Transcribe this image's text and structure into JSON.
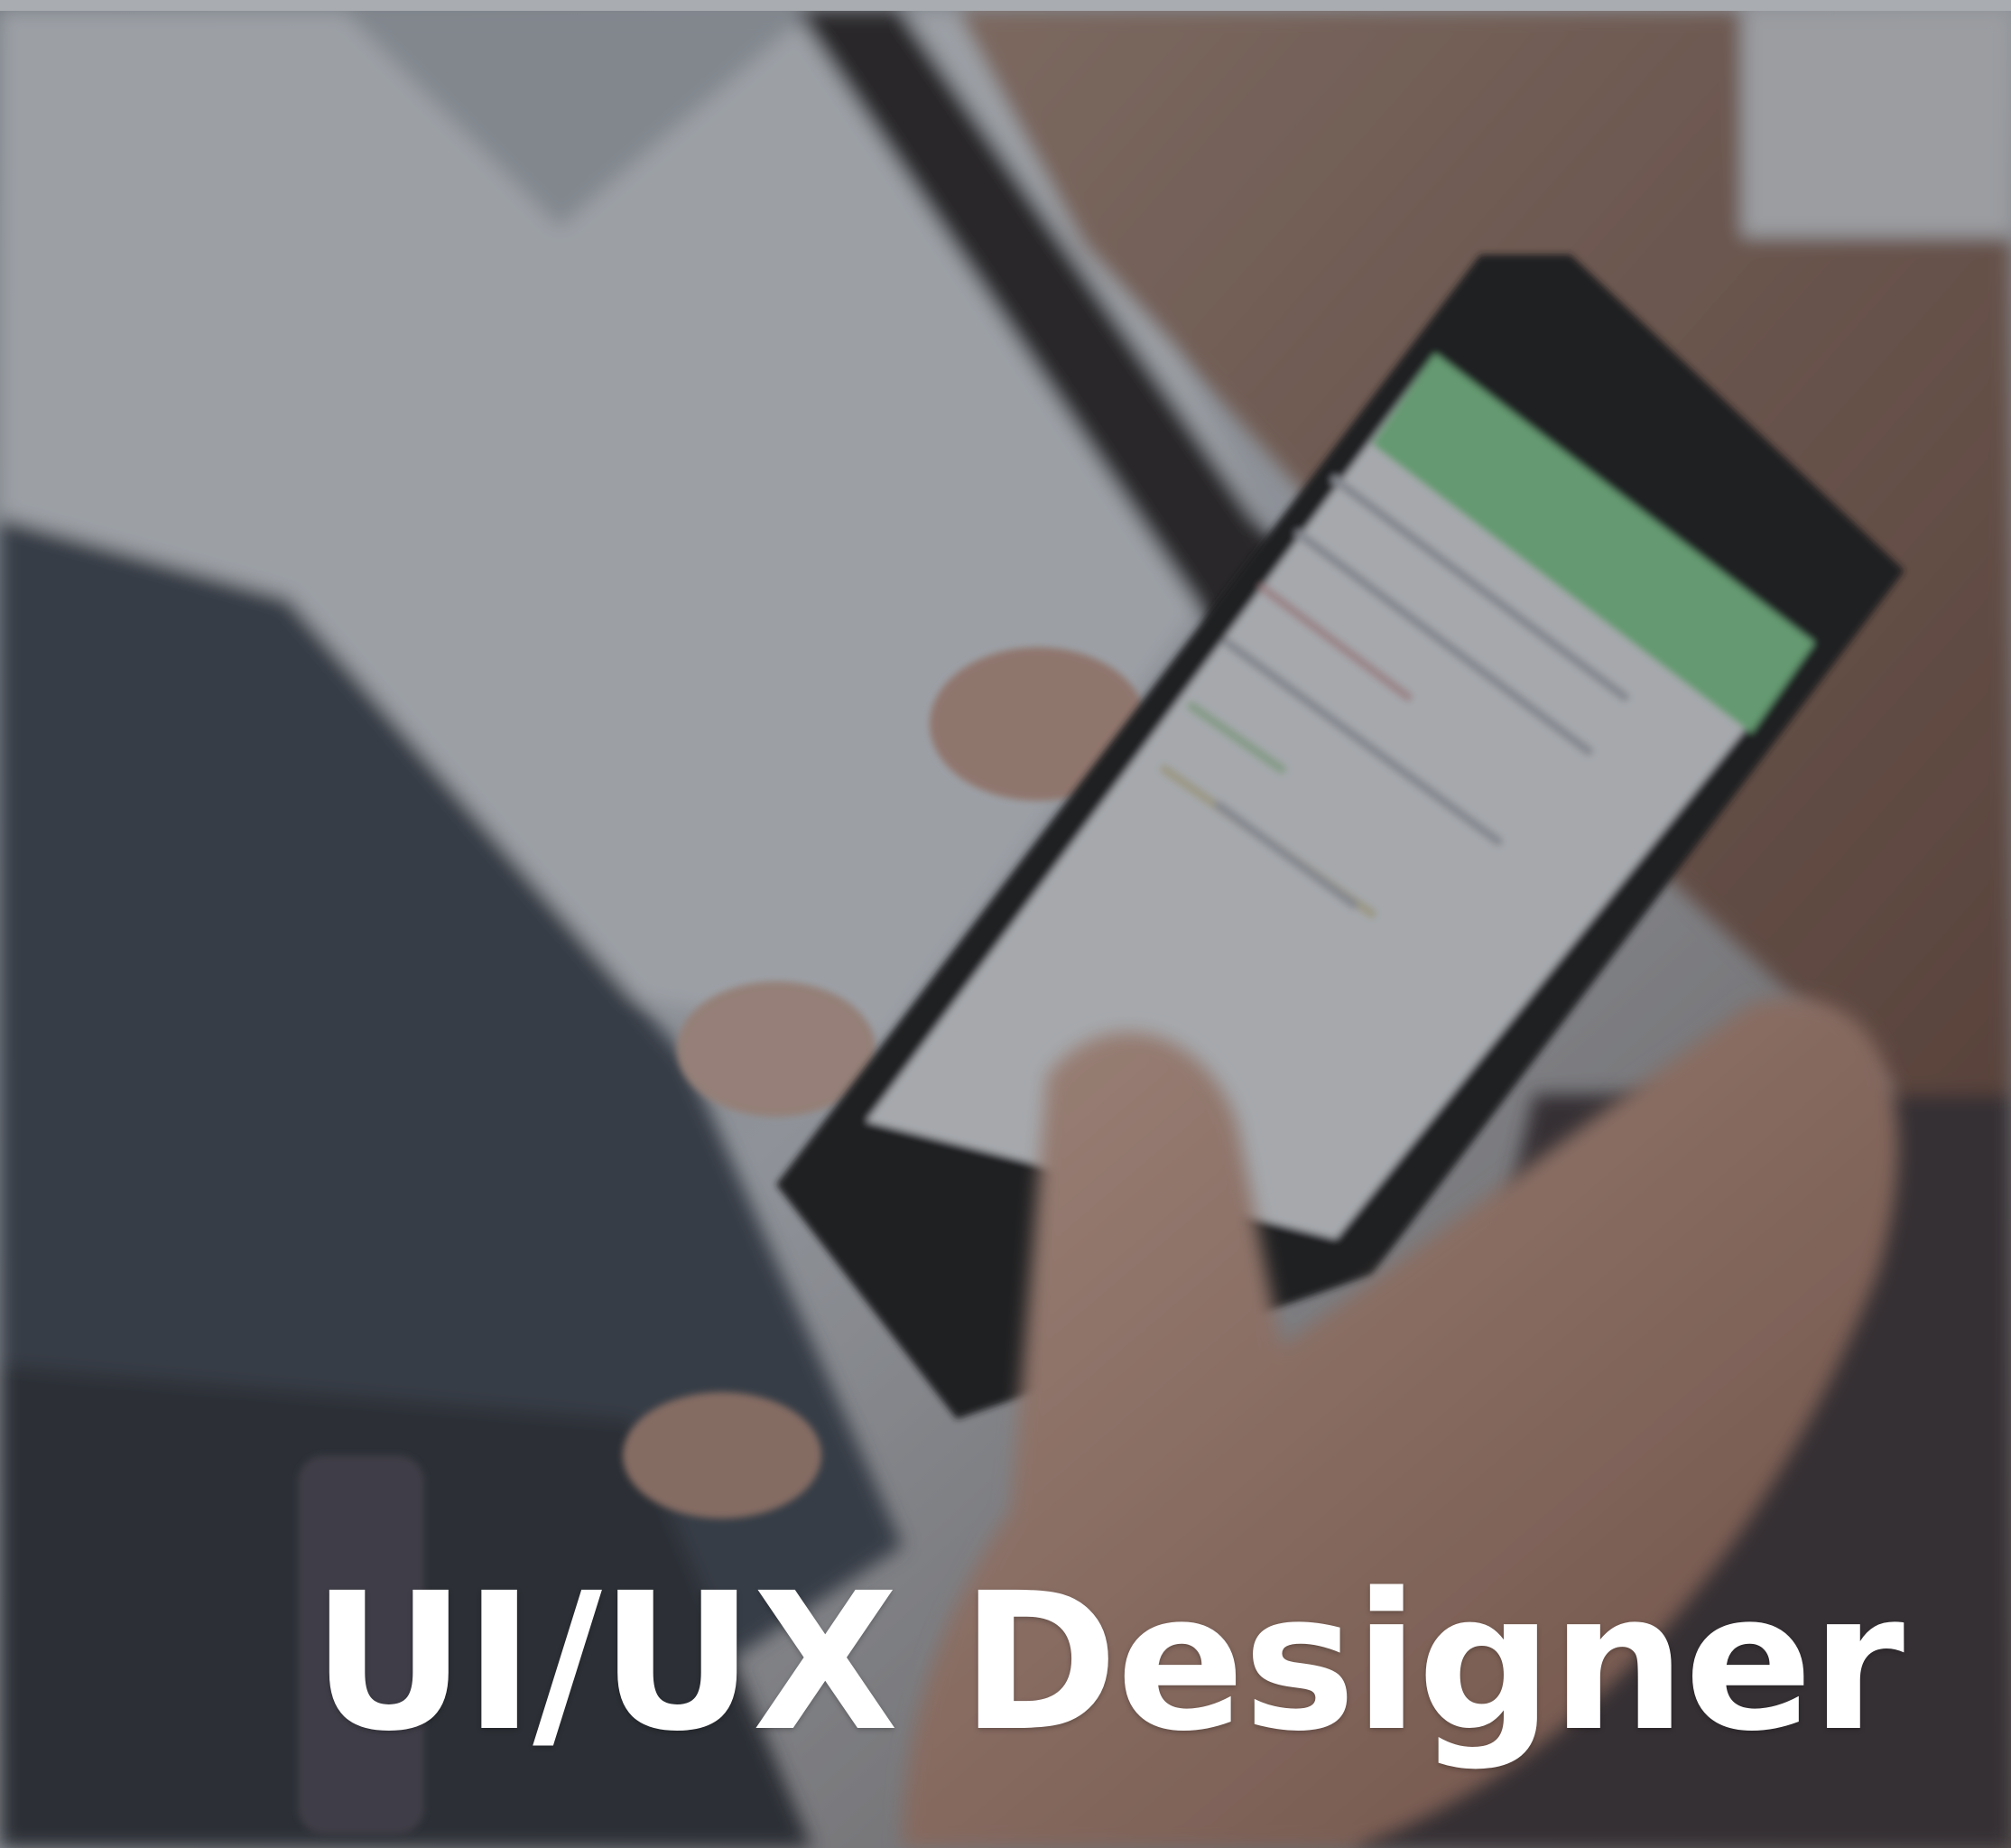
{
  "card": {
    "title": "UI/UX Designer"
  },
  "photo": {
    "subject": "hand-holding-smartphone-icon",
    "overlay_color": "#282c34",
    "screen_header_color": "#7cc489"
  }
}
